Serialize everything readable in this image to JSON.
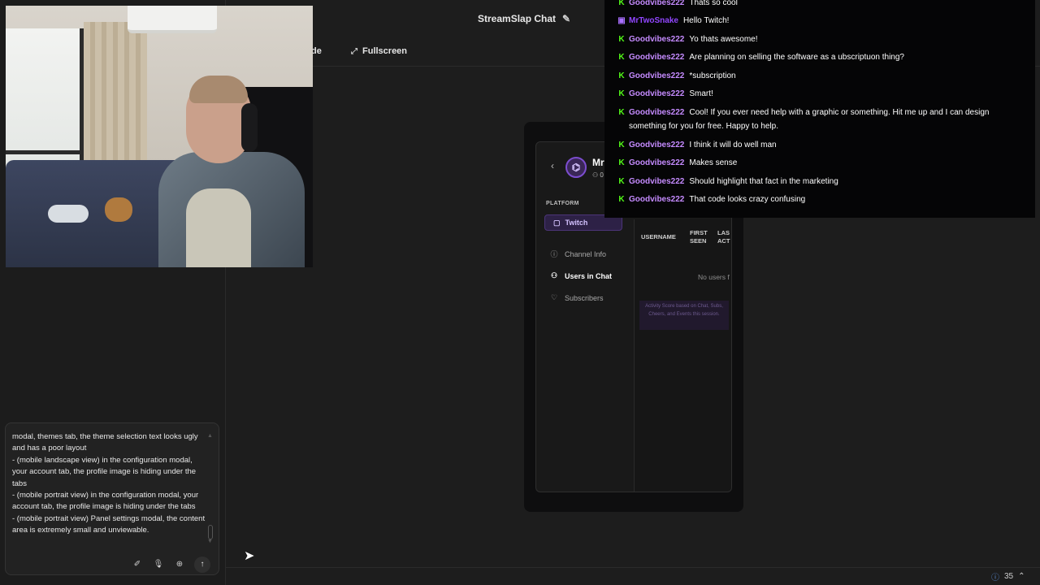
{
  "header": {
    "title": "StreamSlap Chat",
    "toolbar_partial": "de",
    "fullscreen_label": "Fullscreen"
  },
  "chat": {
    "messages": [
      {
        "badge": "kick",
        "user": "Goodvibes222",
        "text": "Thats so cool",
        "color": "#c58bff"
      },
      {
        "badge": "twitch",
        "user": "MrTwoSnake",
        "text": "Hello Twitch!",
        "color": "#9146ff"
      },
      {
        "badge": "kick",
        "user": "Goodvibes222",
        "text": "Yo thats awesome!",
        "color": "#c58bff"
      },
      {
        "badge": "kick",
        "user": "Goodvibes222",
        "text": "Are planning on selling the software as a ubscriptuon thing?",
        "color": "#c58bff"
      },
      {
        "badge": "kick",
        "user": "Goodvibes222",
        "text": "*subscription",
        "color": "#c58bff"
      },
      {
        "badge": "kick",
        "user": "Goodvibes222",
        "text": "Smart!",
        "color": "#c58bff"
      },
      {
        "badge": "kick",
        "user": "Goodvibes222",
        "text": "Cool! If you ever need help with a graphic or something. Hit me up and I can design something for you for free. Happy to help.",
        "color": "#c58bff"
      },
      {
        "badge": "kick",
        "user": "Goodvibes222",
        "text": "I think it will do well man",
        "color": "#c58bff"
      },
      {
        "badge": "kick",
        "user": "Goodvibes222",
        "text": "Makes sense",
        "color": "#c58bff"
      },
      {
        "badge": "kick",
        "user": "Goodvibes222",
        "text": "Should highlight that fact in the marketing",
        "color": "#c58bff"
      },
      {
        "badge": "kick",
        "user": "Goodvibes222",
        "text": "That code looks crazy confusing",
        "color": "#c58bff"
      }
    ]
  },
  "panel": {
    "back_icon": "chevron-left-icon",
    "name_partial": "Mr",
    "subcount_partial": "0",
    "platform_label": "PLATFORM",
    "platform_button": "Twitch",
    "nav": [
      {
        "label": "Channel Info",
        "icon": "info-icon"
      },
      {
        "label": "Users in Chat",
        "icon": "users-icon",
        "active": true
      },
      {
        "label": "Subscribers",
        "icon": "heart-icon"
      }
    ],
    "table": {
      "headers": [
        "USERNAME",
        "FIRST SEEN",
        "LAS ACT"
      ],
      "empty_text": "No users f",
      "note": "Activity Score based on Chat, Subs, Cheers, and Events this session."
    }
  },
  "composer": {
    "text": "modal, themes tab, the theme selection text looks ugly and has a poor layout\n- (mobile landscape view) in the configuration modal, your account tab, the profile image is hiding under the tabs\n- (mobile portrait view) in the configuration modal, your account tab, the profile image is hiding under the tabs\n- (mobile portrait view) Panel settings modal, the content area is extremely small and unviewable."
  },
  "status": {
    "count": "35"
  },
  "colors": {
    "kick_green": "#53fc18",
    "twitch_purple": "#a970ff",
    "username_purple": "#c58bff"
  }
}
